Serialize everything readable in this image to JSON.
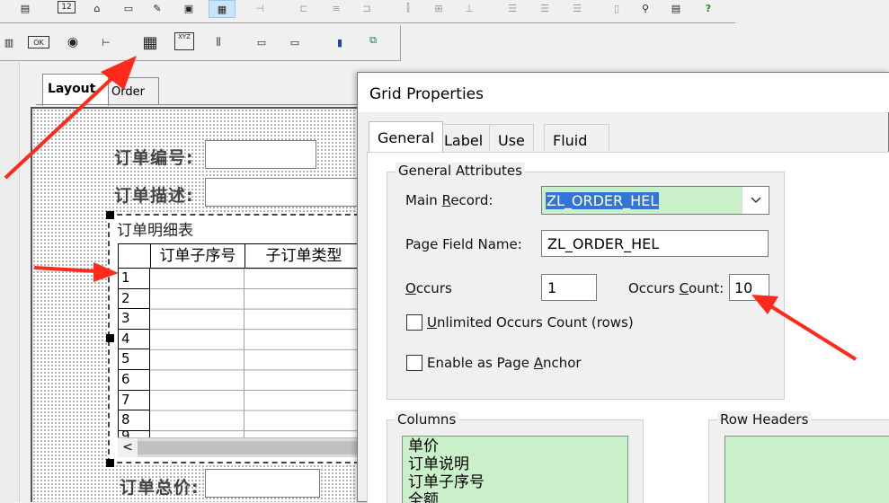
{
  "left_tabs": {
    "layout": "Layout",
    "order": "Order"
  },
  "form": {
    "order_no_label": "订单编号:",
    "order_desc_label": "订单描述:",
    "order_total_label": "订单总价:",
    "grid_title": "订单明细表",
    "grid_columns": [
      "订单子序号",
      "子订单类型"
    ],
    "grid_rows": [
      "1",
      "2",
      "3",
      "4",
      "5",
      "6",
      "7",
      "8",
      "9"
    ],
    "scroll_left": "<"
  },
  "toolbar2": {
    "ok_label": "OK",
    "xyz_label": "XYZ"
  },
  "dialog": {
    "title": "Grid Properties",
    "tabs": [
      "General",
      "Label",
      "Use",
      "Fluid"
    ],
    "general_attributes": {
      "legend": "General Attributes",
      "main_record_pre": "Main ",
      "main_record_acc": "R",
      "main_record_post": "ecord:",
      "main_record_value": "ZL_ORDER_HEL",
      "page_field_label": "Page Field Name:",
      "page_field_value": "ZL_ORDER_HEL",
      "occurs_acc": "O",
      "occurs_post": "ccurs",
      "occurs_value": "1",
      "occurs_count_pre": "Occurs ",
      "occurs_count_acc": "C",
      "occurs_count_post": "ount:",
      "occurs_count_value": "10",
      "unlimited_acc": "U",
      "unlimited_post": "nlimited Occurs Count (rows)",
      "anchor_pre": "Enable as Page ",
      "anchor_acc": "A",
      "anchor_post": "nchor"
    },
    "columns": {
      "legend": "Columns",
      "items": [
        "单价",
        "订单说明",
        "订单子序号",
        "全额"
      ]
    },
    "row_headers": {
      "legend": "Row Headers"
    }
  },
  "colors": {
    "annotation_arrow": "#ff2a1a",
    "list_bg": "#c9f0c9",
    "selection": "#3375d6"
  }
}
